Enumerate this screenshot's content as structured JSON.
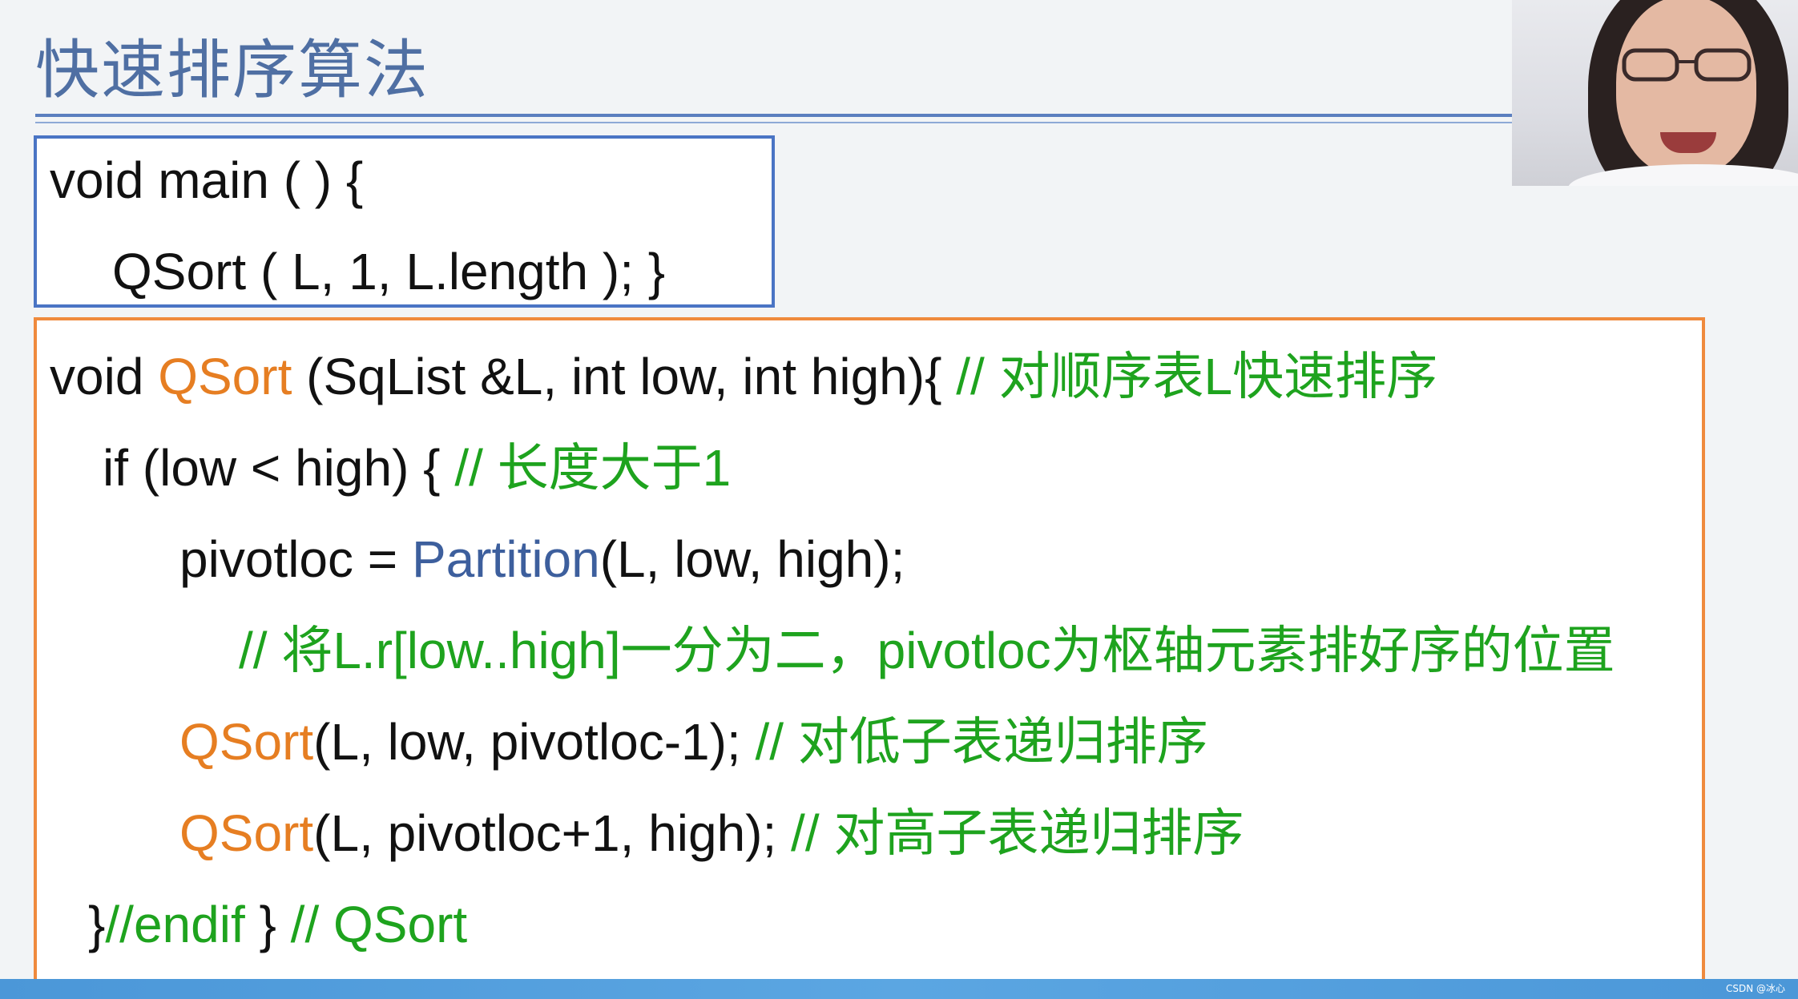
{
  "slide": {
    "title": "快速排序算法",
    "watermark": "CSDN @冰心"
  },
  "main_code": {
    "line1": "void main ( ) {",
    "line2": "QSort ( L, 1, L.length ); }"
  },
  "qsort_code": {
    "line1": {
      "prefix": "void ",
      "fn": "QSort",
      "rest": " (SqList &L, int low, int high){  ",
      "comment": "// 对顺序表L快速排序"
    },
    "line2": {
      "code": "if (low < high) {  ",
      "comment": "// 长度大于1"
    },
    "line3": {
      "prefix": "pivotloc = ",
      "fn": "Partition",
      "rest": "(L, low, high);"
    },
    "line4": {
      "comment": "// 将L.r[low..high]一分为二，pivotloc为枢轴元素排好序的位置"
    },
    "line5": {
      "fn": "QSort",
      "rest": "(L, low, pivotloc-1);   ",
      "comment": "// 对低子表递归排序"
    },
    "line6": {
      "fn": "QSort",
      "rest": "(L, pivotloc+1, high); ",
      "comment": "// 对高子表递归排序"
    },
    "line7": {
      "prefix": "}",
      "comment_endif": "//endif",
      "middle": "  } ",
      "comment_end": "// QSort"
    }
  },
  "colors": {
    "title": "#4f6fa3",
    "main_box_border": "#4a74c4",
    "qsort_box_border": "#ef8a3d",
    "function_name": "#e67e22",
    "partition_call": "#3d5f9d",
    "comment": "#1ea31e",
    "code_text": "#111111"
  }
}
